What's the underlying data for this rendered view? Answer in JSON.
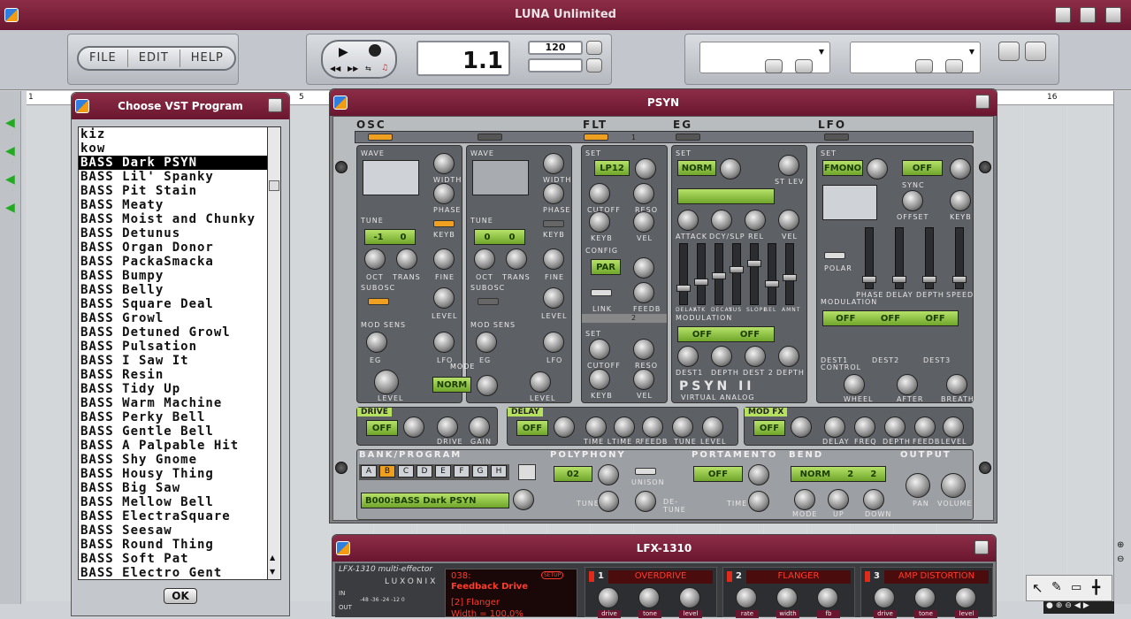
{
  "app": {
    "title": "LUNA Unlimited"
  },
  "toolbar": {
    "menu": [
      "FILE",
      "EDIT",
      "HELP"
    ],
    "position": "1.1",
    "tempo": "120"
  },
  "ruler": {
    "marks": [
      {
        "label": "1"
      },
      {
        "label": "5"
      },
      {
        "label": "16"
      }
    ]
  },
  "vst_window": {
    "title": "Choose VST Program",
    "ok": "OK",
    "selected_index": 2,
    "programs": [
      "kiz",
      "kow",
      "BASS Dark PSYN",
      "BASS Lil' Spanky",
      "BASS Pit Stain",
      "BASS Meaty",
      "BASS Moist and Chunky",
      "BASS Detunus",
      "BASS Organ Donor",
      "BASS PackaSmacka",
      "BASS Bumpy",
      "BASS Belly",
      "BASS Square Deal",
      "BASS Growl",
      "BASS Detuned Growl",
      "BASS Pulsation",
      "BASS I Saw It",
      "BASS Resin",
      "BASS Tidy Up",
      "BASS Warm Machine",
      "BASS Perky Bell",
      "BASS Gentle Bell",
      "BASS A Palpable Hit",
      "BASS Shy Gnome",
      "BASS Housy Thing",
      "BASS Big Saw",
      "BASS Mellow Bell",
      "BASS ElectraSquare",
      "BASS Seesaw",
      "BASS Round Thing",
      "BASS Soft Pat",
      "BASS Electro Gent"
    ]
  },
  "psyn": {
    "title": "PSYN",
    "sections": {
      "osc": "OSC",
      "flt": "FLT",
      "eg": "EG",
      "lfo": "LFO"
    },
    "osc1": {
      "wave": "WAVE",
      "width": "WIDTH",
      "phase": "PHASE",
      "tune": "TUNE",
      "tune_val_a": "-1",
      "tune_val_b": "0",
      "keyb": "KEYB",
      "oct": "OCT",
      "trans": "TRANS",
      "fine": "FINE",
      "subosc": "SUBOSC",
      "level": "LEVEL",
      "modsens": "MOD SENS",
      "eg": "EG",
      "lfo": "LFO"
    },
    "osc2": {
      "tune_val_a": "0",
      "tune_val_b": "0"
    },
    "mode": {
      "label": "MODE",
      "value": "NORM",
      "level": "LEVEL"
    },
    "flt": {
      "set": "SET",
      "type": "LP12",
      "cutoff": "CUTOFF",
      "reso": "RESO",
      "keyb": "KEYB",
      "vel": "VEL",
      "config": "CONFIG",
      "config_val": "PAR",
      "link": "LINK",
      "feedb": "FEEDB",
      "set2": "SET",
      "tab2": "2",
      "tab1": "1"
    },
    "eg": {
      "set": "SET",
      "mode": "NORM",
      "st_lev": "ST LEV",
      "attack": "ATTACK",
      "dcy_slp": "DCY/SLP",
      "rel": "REL",
      "vel": "VEL",
      "sliders": [
        "DELAY",
        "ATK",
        "DECAY",
        "SUS",
        "SLOPE",
        "REL",
        "AMNT"
      ],
      "modulation": "MODULATION",
      "mod_a": "OFF",
      "mod_b": "OFF",
      "dest1": "DEST1",
      "depth": "DEPTH",
      "dest2": "DEST 2",
      "logo": "PSYN II",
      "logo_sub": "VIRTUAL ANALOG"
    },
    "lfo": {
      "set": "SET",
      "mode": "FMONO",
      "sync_val": "OFF",
      "sync": "SYNC",
      "offset": "OFFSET",
      "keyb": "KEYB",
      "polar": "POLAR",
      "phase": "PHASE",
      "delay": "DELAY",
      "depth": "DEPTH",
      "speed": "SPEED",
      "modulation": "MODULATION",
      "mods": [
        "OFF",
        "OFF",
        "OFF"
      ],
      "dest1": "DEST1",
      "dest2": "DEST2",
      "dest3": "DEST3",
      "control": "CONTROL",
      "wheel": "WHEEL",
      "after": "AFTER",
      "breath": "BREATH"
    },
    "drive": {
      "label": "DRIVE",
      "value": "OFF",
      "drive": "DRIVE",
      "gain": "GAIN"
    },
    "delay": {
      "label": "DELAY",
      "value": "OFF",
      "time_l": "TIME L",
      "time_r": "TIME R",
      "feedb": "FEEDB",
      "tune": "TUNE",
      "level": "LEVEL"
    },
    "modfx": {
      "label": "MOD FX",
      "value": "OFF",
      "delay": "DELAY",
      "freq": "FREQ",
      "depth": "DEPTH",
      "feedb": "FEEDB",
      "level": "LEVEL"
    },
    "bank": {
      "label": "BANK/PROGRAM",
      "letters": [
        "A",
        "B",
        "C",
        "D",
        "E",
        "F",
        "G",
        "H"
      ],
      "program": "B000:BASS Dark PSYN"
    },
    "polyphony": {
      "label": "POLYPHONY",
      "value": "02",
      "unison": "UNISON",
      "tune": "TUNE",
      "detune": "DE-TUNE"
    },
    "portamento": {
      "label": "PORTAMENTO",
      "value": "OFF",
      "time": "TIME"
    },
    "bend": {
      "label": "BEND",
      "mode": "NORM",
      "up_val": "2",
      "down_val": "2",
      "mode_lbl": "MODE",
      "up": "UP",
      "down": "DOWN"
    },
    "output": {
      "label": "OUTPUT",
      "pan": "PAN",
      "volume": "VOLUME"
    }
  },
  "lfx": {
    "title": "LFX-1310",
    "brand": "LFX-1310 multi-effector",
    "maker": "LUXONIX",
    "in": "IN",
    "out": "OUT",
    "db": "-48 -36 -24 -12 0",
    "prog_num": "038:",
    "prog_name": "Feedback Drive",
    "setup": "SETUP",
    "param1": "[2] Flanger",
    "param2": "Width = 100.0%",
    "slots": [
      {
        "n": "1",
        "name": "OVERDRIVE",
        "knobs": [
          "drive",
          "tone",
          "level"
        ]
      },
      {
        "n": "2",
        "name": "FLANGER",
        "knobs": [
          "rate",
          "width",
          "fb"
        ]
      },
      {
        "n": "3",
        "name": "AMP DISTORTION",
        "knobs": [
          "drive",
          "tone",
          "level"
        ]
      }
    ]
  },
  "colors": {
    "accent": "#7a1f3a",
    "lcd_green": "#9ccf4a",
    "led": "#f0a020"
  }
}
